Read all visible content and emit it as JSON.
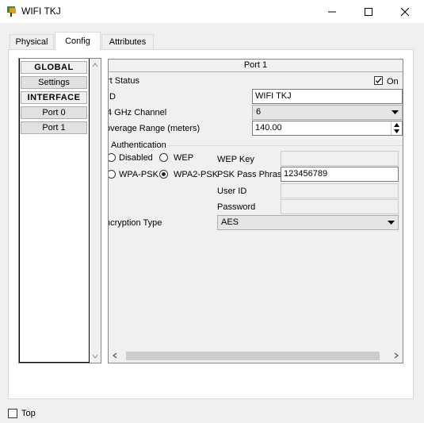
{
  "window": {
    "title": "WIFI TKJ"
  },
  "tabs": [
    {
      "label": "Physical",
      "active": false
    },
    {
      "label": "Config",
      "active": true
    },
    {
      "label": "Attributes",
      "active": false
    }
  ],
  "nav": {
    "items": [
      "GLOBAL",
      "Settings",
      "INTERFACE",
      "Port 0",
      "Port 1"
    ]
  },
  "port": {
    "header": "Port 1",
    "status_label": "rt Status",
    "status_checkbox_label": "On",
    "status_on": true,
    "ssid_label": "ID",
    "ssid_value": "WIFI TKJ",
    "channel_label": "4 GHz Channel",
    "channel_value": "6",
    "range_label": "overage Range (meters)",
    "range_value": "140.00",
    "auth_group_label": "Authentication",
    "auth_options": [
      "Disabled",
      "WEP",
      "WPA-PSK",
      "WPA2-PSK"
    ],
    "auth_selected": "WPA2-PSK",
    "wep_key_label": "WEP Key",
    "wep_key_value": "",
    "psk_label": "PSK Pass Phrase",
    "psk_value": "123456789",
    "user_id_label": "User ID",
    "user_id_value": "",
    "password_label": "Password",
    "password_value": "",
    "encryption_label": "ncryption Type",
    "encryption_value": "AES"
  },
  "footer": {
    "top_label": "Top",
    "top_checked": false
  }
}
